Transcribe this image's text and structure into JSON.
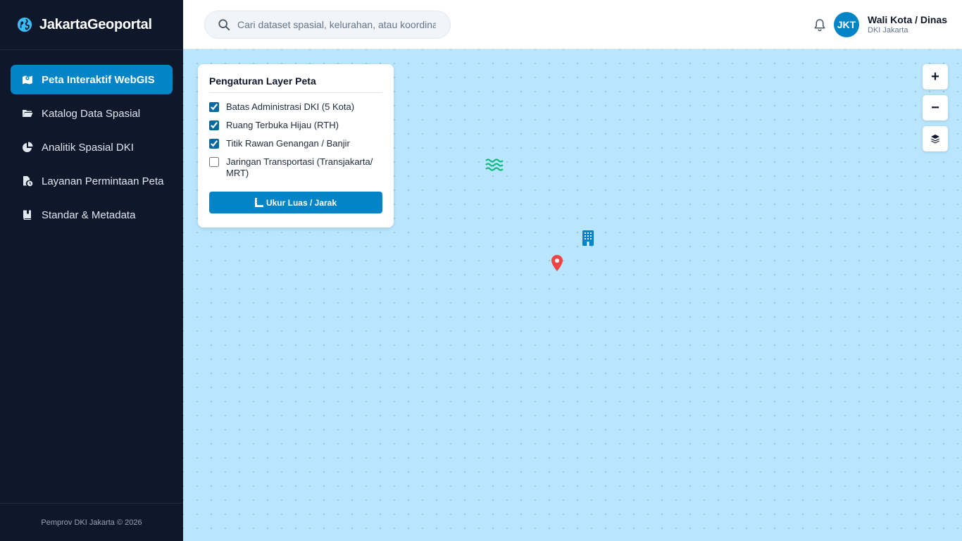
{
  "brand": {
    "name": "JakartaGeoportal",
    "icon": "globe-icon"
  },
  "sidebar": {
    "items": [
      {
        "label": "Peta Interaktif WebGIS",
        "icon": "map-icon",
        "active": true
      },
      {
        "label": "Katalog Data Spasial",
        "icon": "folder-icon",
        "active": false
      },
      {
        "label": "Analitik Spasial DKI",
        "icon": "pie-chart-icon",
        "active": false
      },
      {
        "label": "Layanan Permintaan Peta",
        "icon": "file-clock-icon",
        "active": false
      },
      {
        "label": "Standar & Metadata",
        "icon": "book-icon",
        "active": false
      }
    ],
    "footer": "Pemprov DKI Jakarta © 2026"
  },
  "header": {
    "search_placeholder": "Cari dataset spasial, kelurahan, atau koordinat...",
    "avatar_initials": "JKT",
    "user_name": "Wali Kota / Dinas",
    "user_org": "DKI Jakarta"
  },
  "layer_panel": {
    "title": "Pengaturan Layer Peta",
    "layers": [
      {
        "label": "Batas Administrasi DKI (5 Kota)",
        "checked": true
      },
      {
        "label": "Ruang Terbuka Hijau (RTH)",
        "checked": true
      },
      {
        "label": "Titik Rawan Genangan / Banjir",
        "checked": true
      },
      {
        "label": "Jaringan Transportasi (Transjakarta/ MRT)",
        "checked": false
      }
    ],
    "measure_button": "Ukur Luas / Jarak"
  },
  "map_controls": {
    "zoom_in": "+",
    "zoom_out": "−",
    "layers_icon": "layers-icon"
  },
  "markers": [
    {
      "icon": "water-waves-icon",
      "color": "#10b981"
    },
    {
      "icon": "building-icon",
      "color": "#0284c7"
    },
    {
      "icon": "map-pin-icon",
      "color": "#ef4444"
    }
  ],
  "colors": {
    "accent": "#0284c7",
    "sidebar_bg": "#0f172a",
    "map_bg": "#bae6fd"
  }
}
